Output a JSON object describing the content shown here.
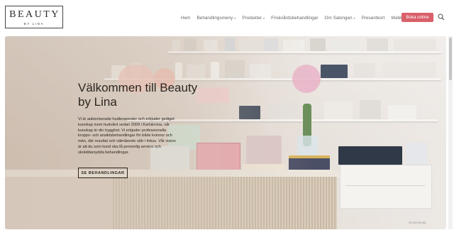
{
  "brand": {
    "name": "BEAUTY",
    "sub": "BY LINA"
  },
  "nav": {
    "items": [
      {
        "label": "Hem",
        "dropdown": false
      },
      {
        "label": "Behandlingsmeny",
        "dropdown": true
      },
      {
        "label": "Produkter",
        "dropdown": true
      },
      {
        "label": "Friskvårdsbehandlingar",
        "dropdown": false
      },
      {
        "label": "Om Salongen",
        "dropdown": true
      },
      {
        "label": "Presentkort",
        "dropdown": false
      },
      {
        "label": "Webbshop",
        "dropdown": false
      }
    ],
    "book_label": "Boka online",
    "chevron": "▾"
  },
  "hero": {
    "title": "Välkommen till Beauty by Lina",
    "text": "Vi är auktoriserade hudterapeuter och erbjuder gediget kunskap inom hudvård sedan 2009 i Karlskrona, vår kunskap är din trygghet. Vi erbjuder professionella kropps- och ansiktsbehandlingar för både kvinnor och män, där resultat och välmående står i fokus. Vår vision är att du som kund ska få personlig service och skräddarsydda behandlingar.",
    "button_label": "SE BEHANDLINGAR"
  },
  "badge": "ScreenSnap",
  "colors": {
    "accent": "#d9606a",
    "text": "#2c2620"
  },
  "icons": {
    "search": "search-icon"
  }
}
